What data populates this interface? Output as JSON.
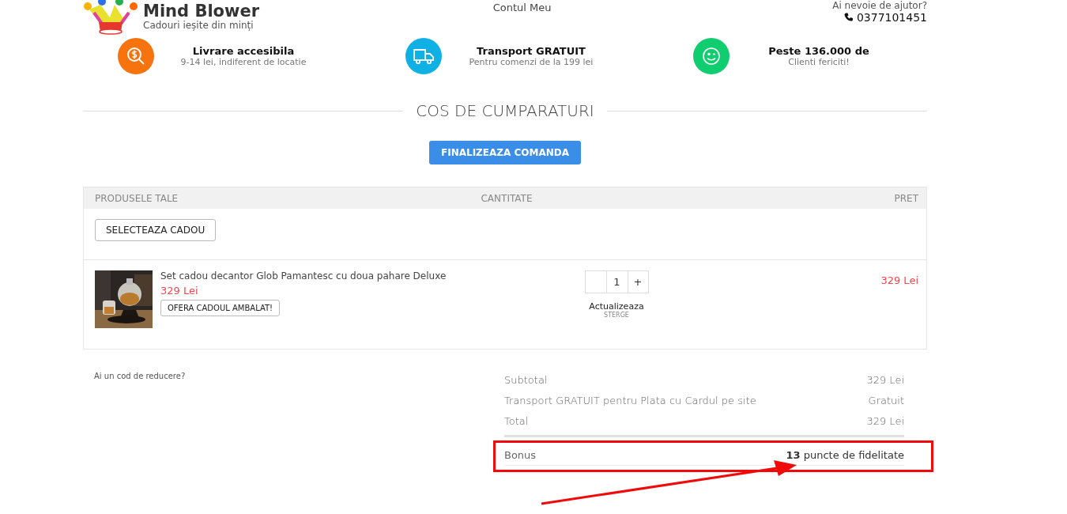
{
  "header": {
    "logo": {
      "name": "Mind Blower",
      "tagline": "Cadouri ieșite din minți"
    },
    "account_link": "Contul Meu",
    "help": {
      "label": "Ai nevoie de ajutor?",
      "phone": "0377101451"
    }
  },
  "features": [
    {
      "kind": "money",
      "color": "#f7730e",
      "title": "Livrare accesibila",
      "subtitle": "9-14 lei, indiferent de locatie"
    },
    {
      "kind": "truck",
      "color": "#0fb0e3",
      "title": "Transport GRATUIT",
      "subtitle": "Pentru comenzi de la 199 lei"
    },
    {
      "kind": "smile",
      "color": "#10cd6f",
      "title": "Peste 136.000 de",
      "subtitle": "Clienti fericiti!"
    }
  ],
  "heading": "COS DE CUMPARATURI",
  "checkout_button": "FINALIZEAZA COMANDA",
  "cart": {
    "columns": [
      "PRODUSELE TALE",
      "CANTITATE",
      "PRET"
    ],
    "gift_button": "SELECTEAZA CADOU",
    "items": [
      {
        "kind": "picture",
        "name": "Set cadou decantor Glob Pamantesc cu doua pahare Deluxe",
        "unit_price": "329 Lei",
        "wrap_button": "OFERA CADOUL AMBALAT!",
        "quantity": "1",
        "increment": "+",
        "update_link": "Actualizeaza",
        "remove_link": "STERGE",
        "price": "329 Lei"
      }
    ]
  },
  "discount_link": "Ai un cod de reducere?",
  "summary": {
    "rows": [
      {
        "label": "Subtotal",
        "value": "329 Lei"
      },
      {
        "label": "Transport GRATUIT pentru Plata cu Cardul pe site",
        "value": "Gratuit"
      },
      {
        "label": "Total",
        "value": "329 Lei"
      }
    ],
    "bonus": {
      "label": "Bonus",
      "value": "**13** puncte de fidelitate"
    }
  },
  "annotations": {
    "highlight_box": true,
    "pointer_arrow": true
  }
}
